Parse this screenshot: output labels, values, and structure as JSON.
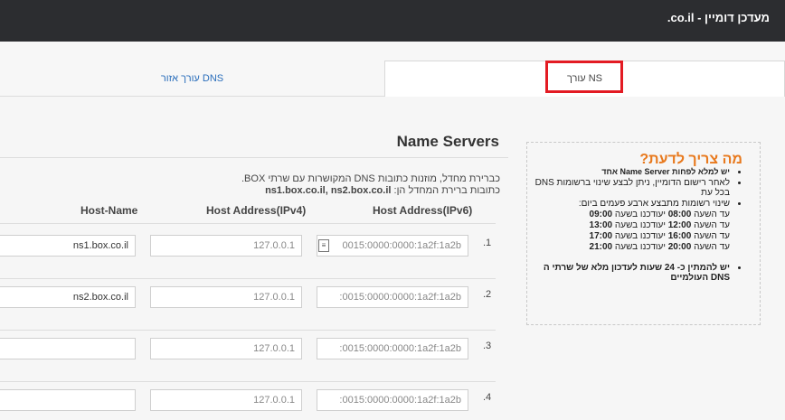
{
  "header": {
    "title": "מעדכן דומיין - co.il."
  },
  "tabs": {
    "dns_zone": "עורך אזור DNS",
    "ns_editor": "עורך NS"
  },
  "info": {
    "title": "מה צריך לדעת?",
    "bullet1": "יש למלא לפחות Name Server אחד",
    "bullet2": "לאחר רישום הדומיין, ניתן לבצע שינוי ברשומות DNS בכל עת",
    "bullet3": "שינוי רשומות מתבצע ארבע פעמים ביום:",
    "schedule": [
      {
        "prefix": "עד השעה",
        "from": "08:00",
        "mid": "יעודכנו בשעה",
        "to": "09:00"
      },
      {
        "prefix": "עד השעה",
        "from": "12:00",
        "mid": "יעודכנו בשעה",
        "to": "13:00"
      },
      {
        "prefix": "עד השעה",
        "from": "16:00",
        "mid": "יעודכנו בשעה",
        "to": "17:00"
      },
      {
        "prefix": "עד השעה",
        "from": "20:00",
        "mid": "יעודכנו בשעה",
        "to": "21:00"
      }
    ],
    "bullet4": "יש להמתין כ- 24 שעות לעדכון מלא של שרתי ה DNS העולמיים"
  },
  "ns": {
    "title": "Name Servers",
    "desc_line1": "כברירת מחדל, מוזנות כתובות DNS המקושרות עם שרתי BOX.",
    "desc_line2_prefix": "כתובות ברירת המחדל הן:",
    "desc_line2_values": "ns1.box.co.il, ns2.box.co.il",
    "col_ipv6": "Host Address(IPv6)",
    "col_ipv4": "Host Address(IPv4)",
    "col_host": "Host-Name",
    "rows": [
      {
        "num": ".1",
        "ipv6": "0015:0000:0000:1a2f:1a2b",
        "ipv4": "127.0.0.1",
        "host": "ns1.box.co.il"
      },
      {
        "num": ".2",
        "ipv6": ":0015:0000:0000:1a2f:1a2b",
        "ipv4": "127.0.0.1",
        "host": "ns2.box.co.il"
      },
      {
        "num": ".3",
        "ipv6": ":0015:0000:0000:1a2f:1a2b",
        "ipv4": "127.0.0.1",
        "host": ""
      },
      {
        "num": ".4",
        "ipv6": ":0015:0000:0000:1a2f:1a2b",
        "ipv4": "127.0.0.1",
        "host": ""
      }
    ]
  }
}
